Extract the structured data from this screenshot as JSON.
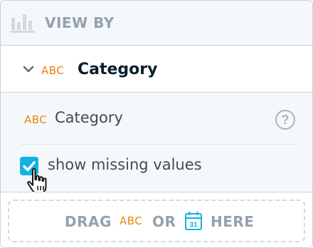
{
  "header": {
    "title": "VIEW BY",
    "icon": "bar-chart-icon"
  },
  "selected_item": {
    "type_tag": "ABC",
    "label": "Category",
    "expanded": true
  },
  "config": {
    "type_tag": "ABC",
    "label": "Category",
    "help_icon": "?",
    "checkbox": {
      "label": "show missing values",
      "checked": true
    }
  },
  "dropzone": {
    "drag": "DRAG",
    "abc": "ABC",
    "or": "OR",
    "calendar_day": "31",
    "here": "HERE"
  },
  "colors": {
    "accent_orange": "#e8860d",
    "checkbox_blue": "#14b2e2",
    "calendar_blue": "#14b2e2",
    "muted_text": "#94a1ad"
  }
}
